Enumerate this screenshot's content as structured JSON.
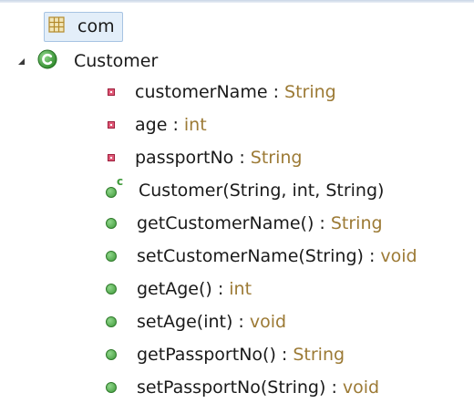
{
  "tree": {
    "package": {
      "label": "com"
    },
    "class": {
      "label": "Customer"
    },
    "members": [
      {
        "kind": "field",
        "name": "customerName",
        "sep": " : ",
        "type": "String"
      },
      {
        "kind": "field",
        "name": "age",
        "sep": " : ",
        "type": "int"
      },
      {
        "kind": "field",
        "name": "passportNo",
        "sep": " : ",
        "type": "String"
      },
      {
        "kind": "constructor",
        "name": "Customer(String, int, String)",
        "sep": "",
        "type": "",
        "ctor_badge": "c"
      },
      {
        "kind": "method",
        "name": "getCustomerName()",
        "sep": " : ",
        "type": "String"
      },
      {
        "kind": "method",
        "name": "setCustomerName(String)",
        "sep": " : ",
        "type": "void"
      },
      {
        "kind": "method",
        "name": "getAge()",
        "sep": " : ",
        "type": "int"
      },
      {
        "kind": "method",
        "name": "setAge(int)",
        "sep": " : ",
        "type": "void"
      },
      {
        "kind": "method",
        "name": "getPassportNo()",
        "sep": " : ",
        "type": "String"
      },
      {
        "kind": "method",
        "name": "setPassportNo(String)",
        "sep": " : ",
        "type": "void"
      }
    ]
  },
  "colors": {
    "type_text": "#9c7a35",
    "selection_bg": "#e3eef9",
    "method_icon": "#3f9a3a",
    "field_icon": "#e15a78",
    "class_icon": "#3f9a3a"
  },
  "icons": {
    "package": "package-icon",
    "class": "class-icon",
    "field": "private-field-icon",
    "method": "public-method-icon",
    "constructor": "constructor-icon",
    "expander": "expanded-triangle-icon"
  }
}
